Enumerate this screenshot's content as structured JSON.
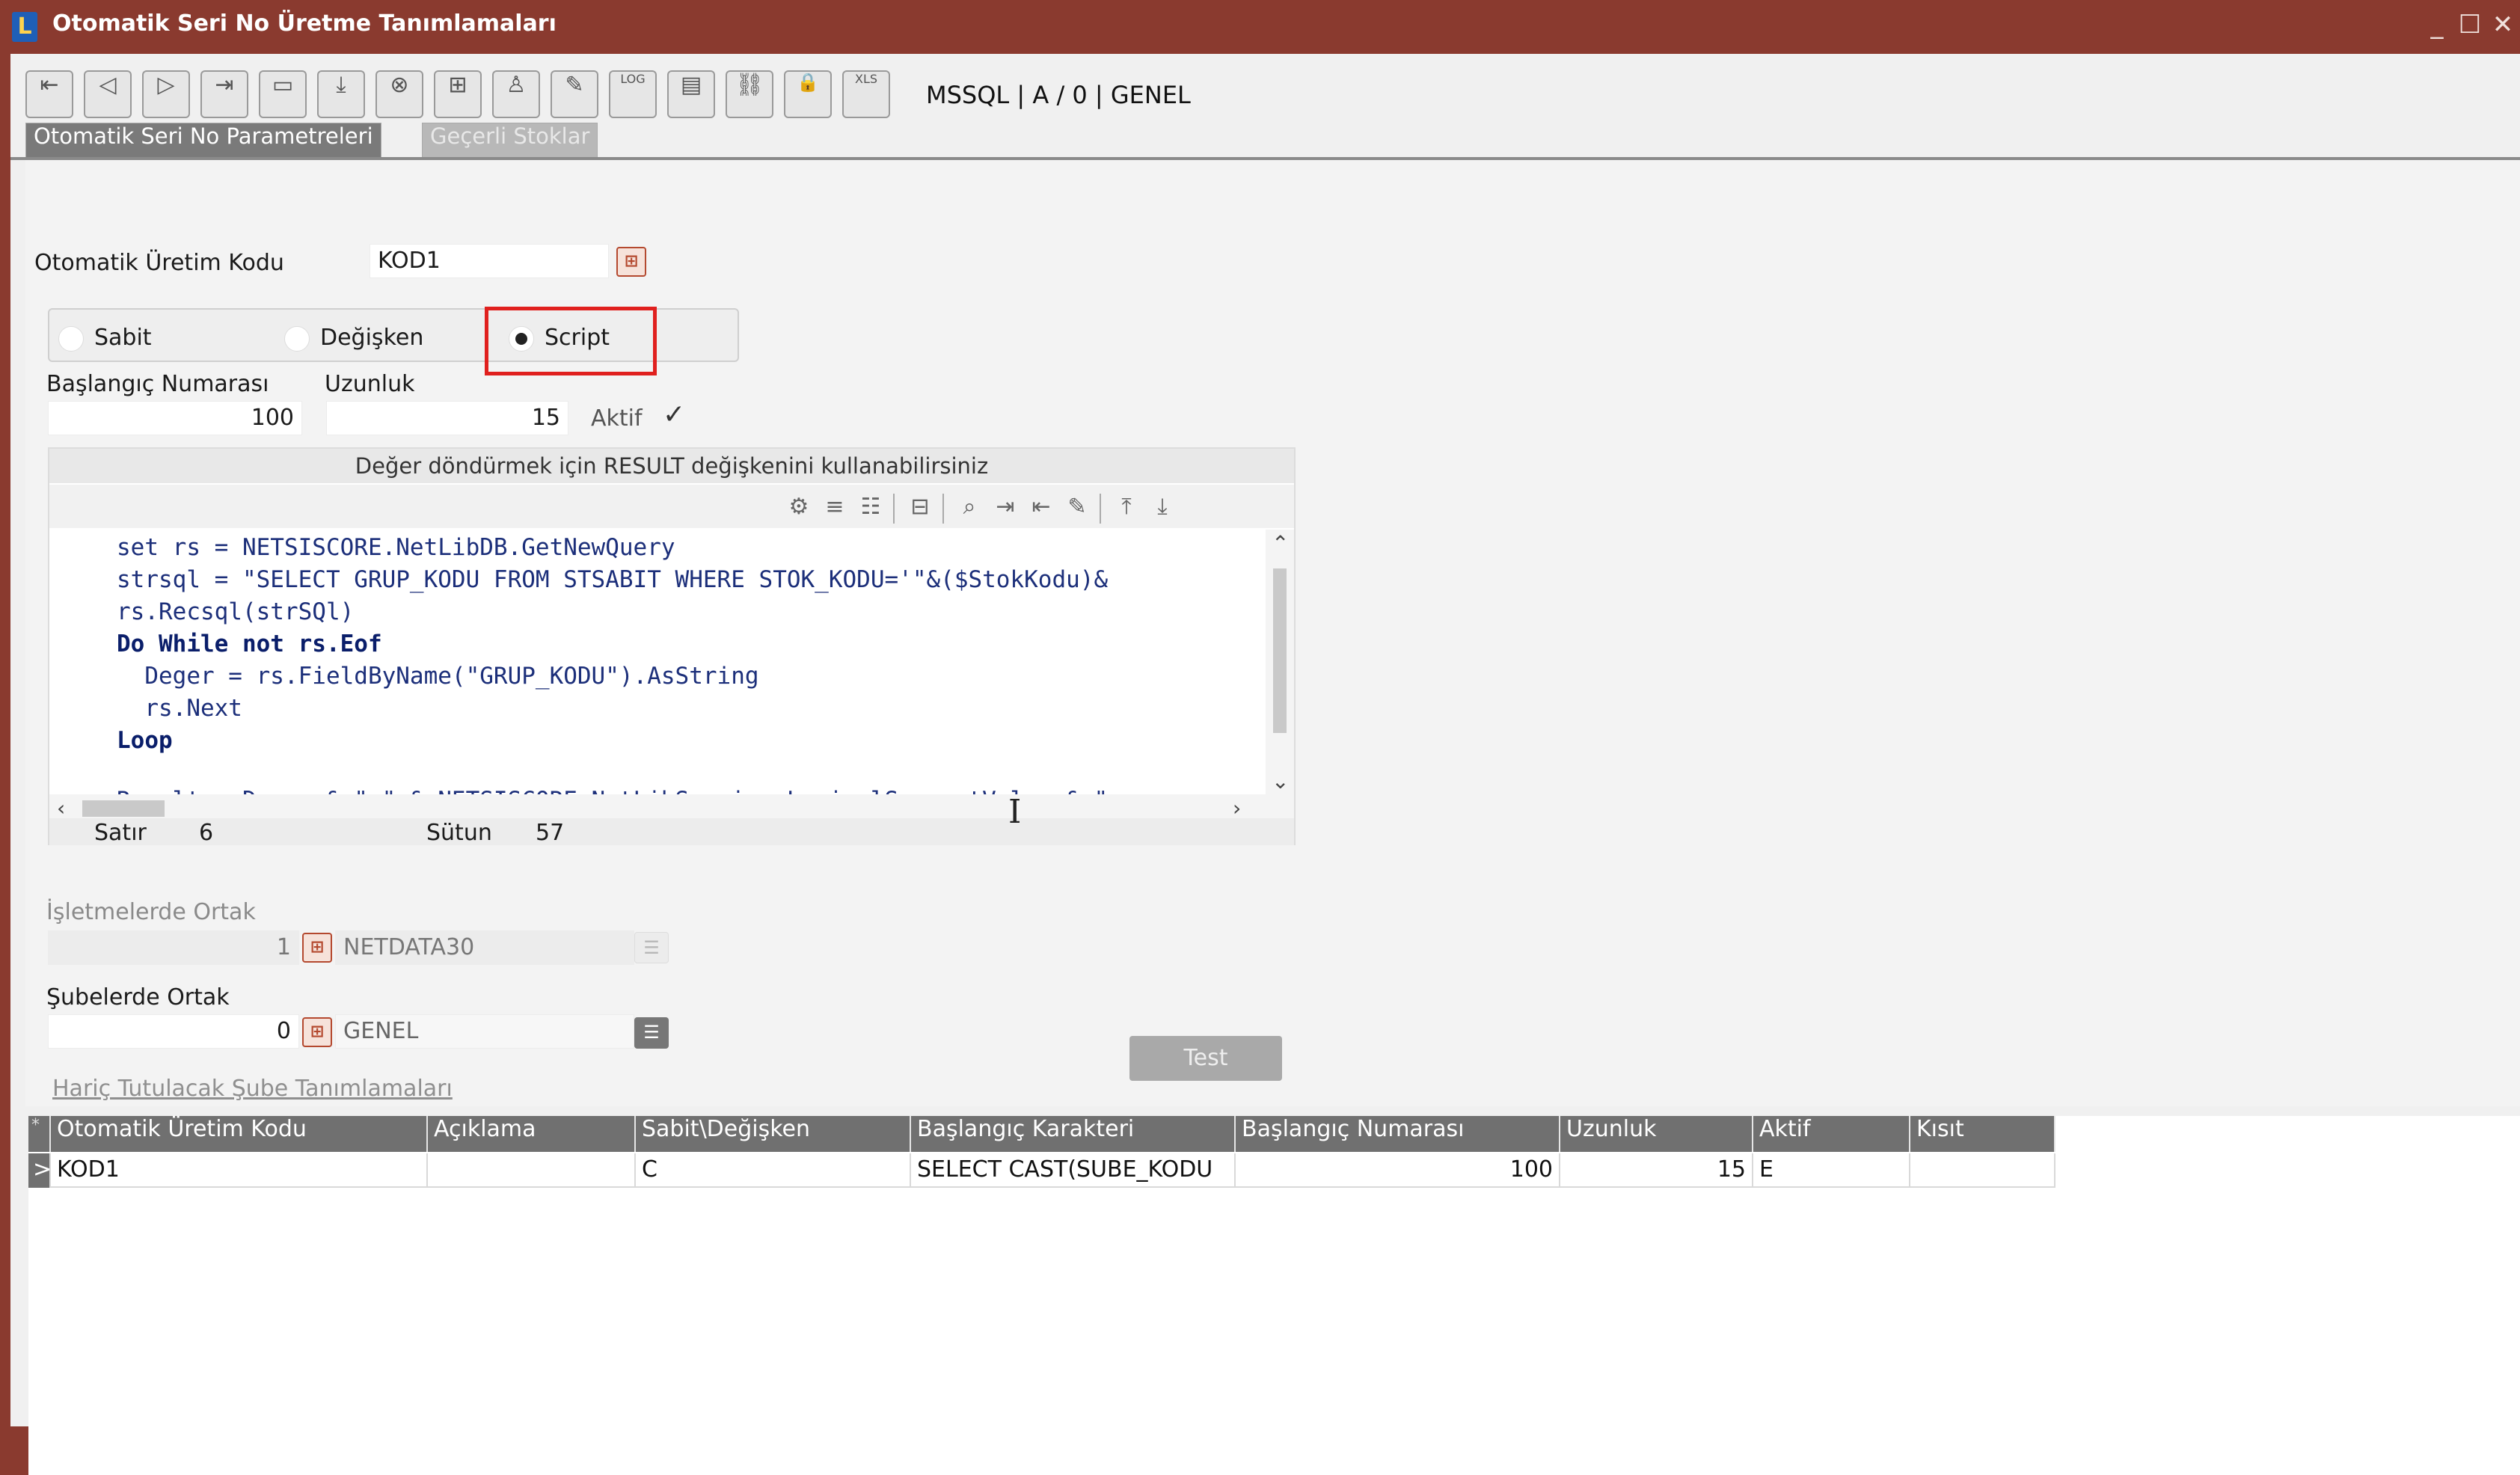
{
  "window": {
    "title": "Otomatik Seri No Üretme Tanımlamaları",
    "logo_letter": "L",
    "controls": {
      "minimize": "_",
      "maximize": "☐",
      "close": "✕"
    }
  },
  "toolbar": {
    "buttons": [
      {
        "icon": "first-record-icon",
        "glyph": "⇤"
      },
      {
        "icon": "previous-record-icon",
        "glyph": "◁"
      },
      {
        "icon": "next-record-icon",
        "glyph": "▷"
      },
      {
        "icon": "last-record-icon",
        "glyph": "⇥"
      },
      {
        "icon": "list-icon",
        "glyph": "▭"
      },
      {
        "icon": "save-icon",
        "glyph": "⤓"
      },
      {
        "icon": "delete-icon",
        "glyph": "⊗"
      },
      {
        "icon": "add-icon",
        "glyph": "⊞"
      },
      {
        "icon": "user-icon",
        "glyph": "♙"
      },
      {
        "icon": "edit-icon",
        "glyph": "✎"
      },
      {
        "icon": "log-icon",
        "glyph": "LOG"
      },
      {
        "icon": "document-icon",
        "glyph": "▤"
      },
      {
        "icon": "link-icon",
        "glyph": "⛓"
      },
      {
        "icon": "lock-icon",
        "glyph": "🔒"
      },
      {
        "icon": "excel-icon",
        "glyph": "XLS"
      }
    ],
    "db_info": "MSSQL | A / 0 | GENEL"
  },
  "tabs": [
    {
      "label": "Otomatik Seri No Parametreleri",
      "active": true
    },
    {
      "label": "Geçerli Stoklar",
      "active": false
    }
  ],
  "form": {
    "uretim_kodu_label": "Otomatik Üretim Kodu",
    "uretim_kodu_value": "KOD1",
    "radio": {
      "sabit": "Sabit",
      "degisken": "Değişken",
      "script": "Script",
      "selected": "Script"
    },
    "baslangic_label": "Başlangıç Numarası",
    "baslangic_value": "100",
    "uzunluk_label": "Uzunluk",
    "uzunluk_value": "15",
    "aktif_label": "Aktif",
    "aktif_checked": true,
    "aktif_mark": "✓"
  },
  "editor": {
    "hint": "Değer döndürmek için RESULT değişkenini kullanabilirsiniz",
    "tools": [
      {
        "icon": "settings-icon",
        "glyph": "⚙"
      },
      {
        "icon": "format-icon",
        "glyph": "≡"
      },
      {
        "icon": "line-numbers-icon",
        "glyph": "☷"
      },
      {
        "icon": "database-icon",
        "glyph": "⊟"
      },
      {
        "icon": "search-icon",
        "glyph": "⌕"
      },
      {
        "icon": "find-next-icon",
        "glyph": "⇥"
      },
      {
        "icon": "find-previous-icon",
        "glyph": "⇤"
      },
      {
        "icon": "eraser-icon",
        "glyph": "✎"
      },
      {
        "icon": "upload-icon",
        "glyph": "⤒"
      },
      {
        "icon": "download-icon",
        "glyph": "⤓"
      }
    ],
    "lines": [
      "set rs = NETSISCORE.NetLibDB.GetNewQuery",
      "strsql = \"SELECT GRUP_KODU FROM STSABIT WHERE STOK_KODU='\"&($StokKodu)&",
      "rs.Recsql(strSQl)",
      "Do While not rs.Eof",
      "  Deger = rs.FieldByName(\"GRUP_KODU\").AsString",
      "  rs.Next",
      "Loop",
      "",
      "Result = Deger & \" \" & NETSISCORE.NetLibSession.LogicalSegmentValue & \""
    ],
    "status": {
      "satir_label": "Satır",
      "satir_value": "6",
      "sutun_label": "Sütun",
      "sutun_value": "57"
    }
  },
  "isletme": {
    "label": "İşletmelerde Ortak",
    "value": "1",
    "name": "NETDATA30"
  },
  "sube": {
    "label": "Şubelerde Ortak",
    "value": "0",
    "name": "GENEL"
  },
  "test_button": "Test",
  "excluded_link": "Hariç Tutulacak Şube Tanımlamaları",
  "grid": {
    "marker_header": "*",
    "marker_row": ">",
    "columns": [
      "Otomatik Üretim Kodu",
      "Açıklama",
      "Sabit\\Değişken",
      "Başlangıç Karakteri",
      "Başlangıç Numarası",
      "Uzunluk",
      "Aktif",
      "Kısıt"
    ],
    "rows": [
      [
        "KOD1",
        "",
        "C",
        "SELECT CAST(SUBE_KODU",
        "100",
        "15",
        "E",
        ""
      ]
    ]
  }
}
